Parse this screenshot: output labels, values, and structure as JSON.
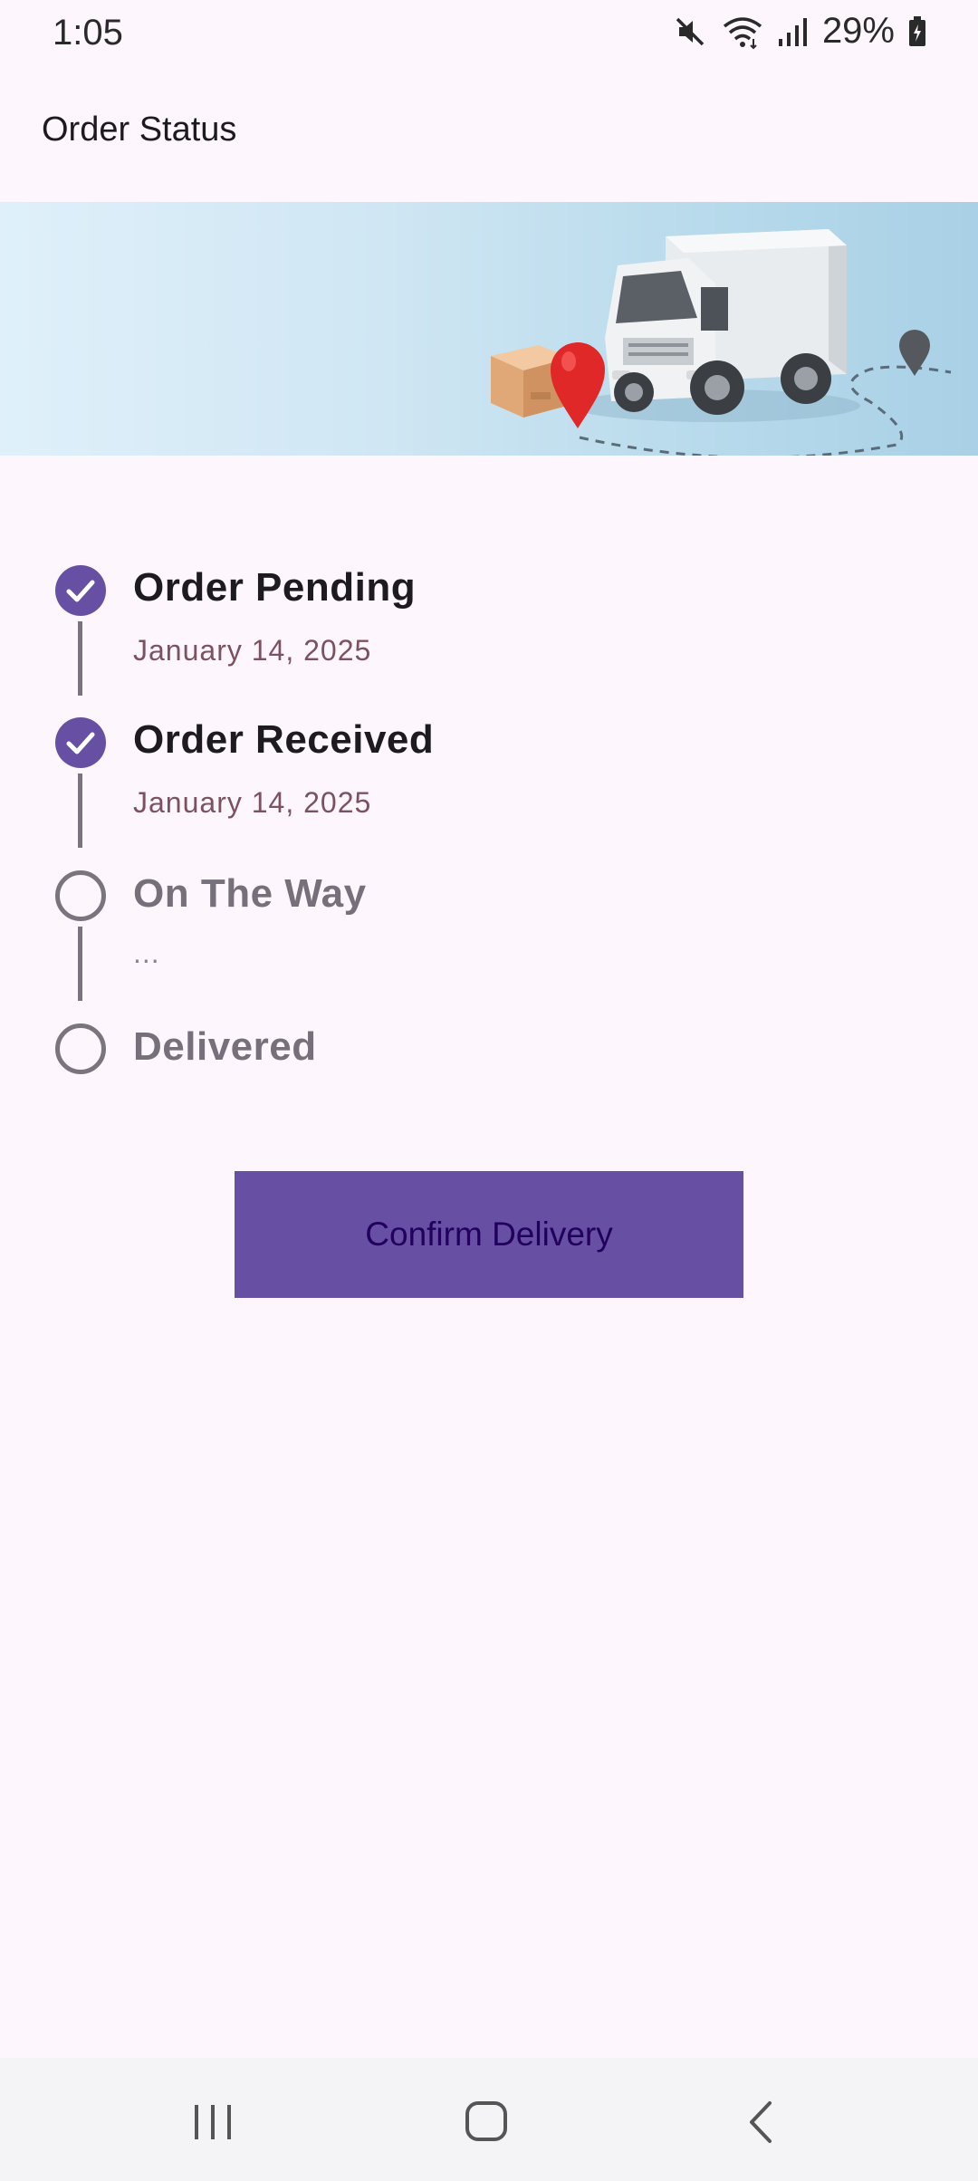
{
  "status_bar": {
    "time": "1:05",
    "battery": "29%",
    "icons": [
      "mute-icon",
      "wifi-icon",
      "signal-icon",
      "battery-icon"
    ]
  },
  "app_bar": {
    "title": "Order Status"
  },
  "banner": {
    "icon": "delivery-truck-illustration"
  },
  "timeline": {
    "steps": [
      {
        "title": "Order Pending",
        "date": "January 14, 2025",
        "state": "completed"
      },
      {
        "title": "Order Received",
        "date": "January 14, 2025",
        "state": "completed"
      },
      {
        "title": "On The Way",
        "date": "...",
        "state": "pending"
      },
      {
        "title": "Delivered",
        "date": "",
        "state": "pending"
      }
    ]
  },
  "actions": {
    "confirm_label": "Confirm Delivery"
  },
  "colors": {
    "accent": "#6750a4",
    "background": "#fdf7fd",
    "inactive": "#79747e",
    "date_text": "#7d5260"
  },
  "nav_bar": {
    "icons": [
      "recents-icon",
      "home-icon",
      "back-icon"
    ]
  }
}
